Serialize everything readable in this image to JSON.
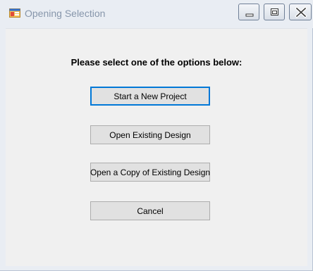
{
  "window": {
    "title": "Opening Selection",
    "app_icon": "windows-form-icon",
    "controls": [
      "minimize-icon",
      "maximize-icon",
      "close-icon"
    ]
  },
  "dialog": {
    "prompt": "Please select one of the options below:",
    "buttons": [
      {
        "label": "Start a New Project",
        "is_default": true
      },
      {
        "label": "Open Existing Design",
        "is_default": false
      },
      {
        "label": "Open a Copy of Existing Design",
        "is_default": false
      },
      {
        "label": "Cancel",
        "is_default": false
      }
    ]
  },
  "colors": {
    "client_bg": "#f0f0f0",
    "button_bg": "#e1e1e1",
    "button_border": "#adadad",
    "focus_border": "#0078d7",
    "title_text": "#8796ab"
  }
}
